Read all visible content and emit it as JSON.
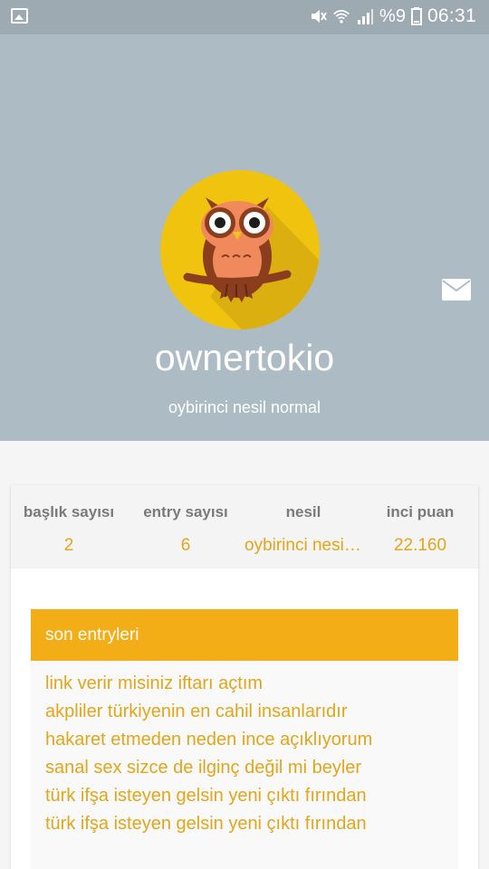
{
  "status_bar": {
    "battery_percent": "%9",
    "time": "06:31"
  },
  "profile": {
    "username": "ownertokio",
    "generation": "oybirinci nesil normal"
  },
  "stats": [
    {
      "label": "başlık sayısı",
      "value": "2"
    },
    {
      "label": "entry sayısı",
      "value": "6"
    },
    {
      "label": "nesil",
      "value": "oybirinci nesil normal"
    },
    {
      "label": "inci puan",
      "value": "22.160"
    }
  ],
  "recent_entries": {
    "title": "son entryleri",
    "items": [
      "link verir misiniz iftarı açtım",
      "akpliler türkiyenin en cahil insanlarıdır",
      "hakaret etmeden neden ince açıklıyorum",
      "sanal sex sizce de ilginç değil mi beyler",
      "türk ifşa isteyen gelsin yeni çıktı fırından",
      "türk ifşa isteyen gelsin yeni çıktı fırından"
    ]
  },
  "icons": {
    "gallery": "image-icon",
    "mute": "mute-icon",
    "wifi": "wifi-icon",
    "signal": "signal-icon",
    "battery": "battery-icon",
    "mail": "mail-icon",
    "avatar": "owl-avatar"
  },
  "colors": {
    "header_bg": "#adbcc4",
    "status_bg": "#9daab2",
    "accent": "#f2ad17",
    "link": "#e3a51a",
    "avatar_bg": "#f0c30f"
  }
}
